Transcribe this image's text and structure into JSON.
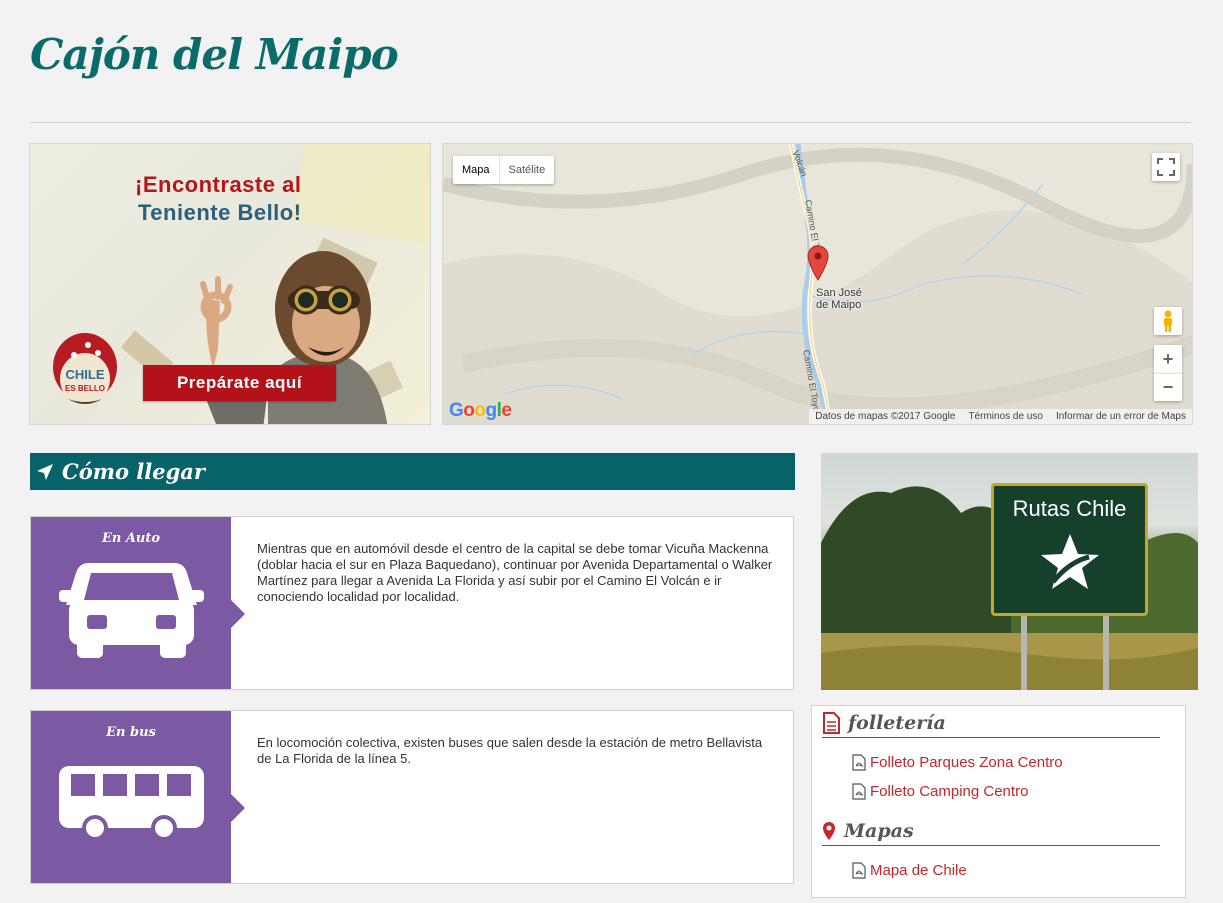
{
  "page": {
    "title": "Cajón del Maipo"
  },
  "banner": {
    "line1": "¡Encontraste al",
    "line2": "Teniente Bello!",
    "cta": "Prepárate aquí",
    "logo_text_1": "CHILE",
    "logo_text_2": "ES BELLO"
  },
  "map": {
    "type_controls": [
      "Mapa",
      "Satélite"
    ],
    "place_label_1": "San José",
    "place_label_2": "de Maipo",
    "road_labels": [
      "Volcán",
      "Camino El Toyo",
      "Camino El Toyo"
    ],
    "zoom_in": "+",
    "zoom_out": "−",
    "footer": [
      "Datos de mapas ©2017 Google",
      "Términos de uso",
      "Informar de un error de Maps"
    ]
  },
  "directions": {
    "header": "Cómo llegar",
    "cards": [
      {
        "label": "En Auto",
        "icon": "car-icon",
        "text": "Mientras que en automóvil desde el centro de la capital se debe tomar Vicuña Mackenna (doblar hacia el sur en Plaza Baquedano), continuar por Avenida Departamental o Walker Martínez para llegar a Avenida La Florida y así subir por el Camino El Volcán e ir conociendo localidad por localidad."
      },
      {
        "label": "En bus",
        "icon": "bus-icon",
        "text": "En locomoción colectiva, existen buses que salen desde la estación de metro Bellavista de La Florida de la línea 5."
      }
    ]
  },
  "rutas": {
    "sign_text": "Rutas Chile"
  },
  "downloads": {
    "folleteria": {
      "heading": "folletería",
      "links": [
        "Folleto Parques Zona Centro",
        "Folleto Camping Centro"
      ]
    },
    "mapas": {
      "heading": "Mapas",
      "links": [
        "Mapa de Chile"
      ]
    }
  },
  "colors": {
    "teal": "#06636a",
    "purple": "#7b5aa3",
    "red": "#c8252c",
    "banner_red": "#b4121a"
  }
}
